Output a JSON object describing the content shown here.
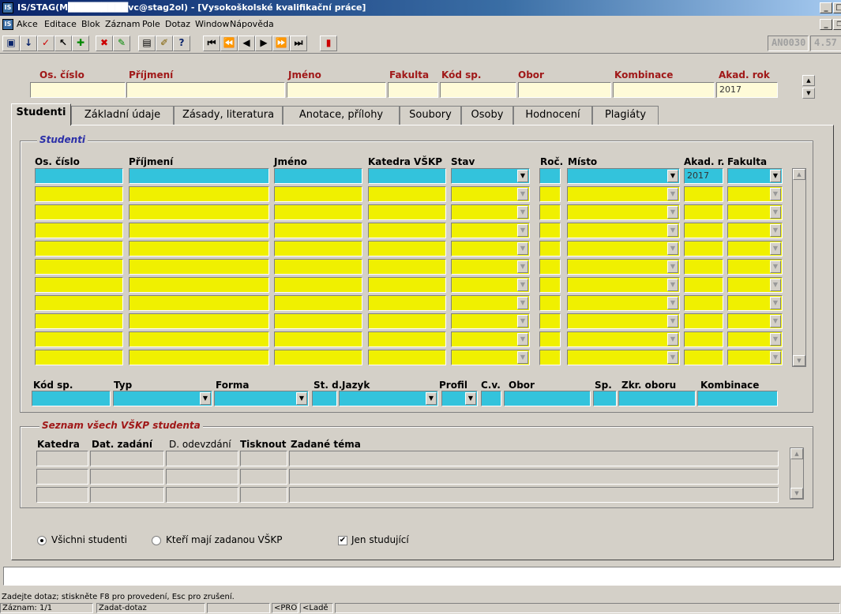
{
  "window": {
    "title": "IS/STAG(M█████████vc@stag2ol) - [Vysokoškolské kvalifikační práce]",
    "minimize": "_",
    "maximize": "□"
  },
  "menu": [
    "Akce",
    "Editace",
    "Blok",
    "Záznam",
    "Pole",
    "Dotaz",
    "Window",
    "Nápověda"
  ],
  "toolbar": {
    "form_code": "AN0030",
    "version": "4.57"
  },
  "query_header": {
    "labels": [
      "Os. číslo",
      "Příjmení",
      "Jméno",
      "Fakulta",
      "Kód sp.",
      "Obor",
      "Kombinace",
      "Akad. rok"
    ],
    "akad_rok_value": "2017"
  },
  "tabs": [
    "Studenti",
    "Základní údaje",
    "Zásady, literatura",
    "Anotace, přílohy",
    "Soubory",
    "Osoby",
    "Hodnocení",
    "Plagiáty"
  ],
  "studenti": {
    "legend": "Studenti",
    "columns": [
      "Os. číslo",
      "Příjmení",
      "Jméno",
      "Katedra VŠKP",
      "Stav",
      "Roč.",
      "Místo",
      "Akad. r.",
      "Fakulta"
    ],
    "first_row_akad_r": "2017"
  },
  "detail": {
    "labels": [
      "Kód sp.",
      "Typ",
      "Forma",
      "St. d.",
      "Jazyk",
      "Profil",
      "C.v.",
      "Obor",
      "Sp.",
      "Zkr. oboru",
      "Kombinace"
    ]
  },
  "seznam": {
    "legend": "Seznam všech VŠKP studenta",
    "columns": [
      "Katedra",
      "Dat. zadání",
      "D. odevzdání",
      "Tisknout",
      "Zadané téma"
    ]
  },
  "filters": {
    "radio_all": "Všichni studenti",
    "radio_with": "Kteří mají zadanou VŠKP",
    "checkbox_only": "Jen studující"
  },
  "status": {
    "message": "Zadejte dotaz; stiskněte F8 pro provedení, Esc  pro zrušení.",
    "record": "Záznam: 1/1",
    "mode": "Zadat-dotaz",
    "pos": "<PŘOS",
    "lade": "<Ladě"
  },
  "colors": {
    "active_row": "#33c3dc",
    "rows": "#f0f000",
    "query_fields": "#fffbd8",
    "label_red": "#a01818"
  }
}
